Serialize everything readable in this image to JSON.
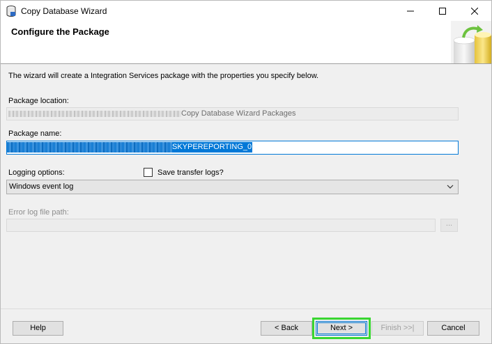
{
  "window": {
    "title": "Copy Database Wizard",
    "icon": "database-icon"
  },
  "header": {
    "title": "Configure the Package",
    "art_icon": "database-arrow-icon"
  },
  "content": {
    "intro": "The wizard will create a Integration Services package with the properties you specify below.",
    "package_location": {
      "label": "Package location:",
      "value_suffix": "Copy Database Wizard Packages"
    },
    "package_name": {
      "label": "Package name:",
      "value_suffix": "SKYPEREPORTING_0"
    },
    "logging": {
      "label": "Logging options:",
      "save_logs_label": "Save transfer logs?",
      "save_logs_checked": false,
      "selected": "Windows event log"
    },
    "error_log": {
      "label": "Error log file path:",
      "value": "",
      "browse_label": "..."
    }
  },
  "footer": {
    "help": "Help",
    "back": "< Back",
    "next": "Next >",
    "finish": "Finish >>|",
    "cancel": "Cancel"
  },
  "colors": {
    "accent": "#0078d7",
    "highlight": "#39d631"
  }
}
